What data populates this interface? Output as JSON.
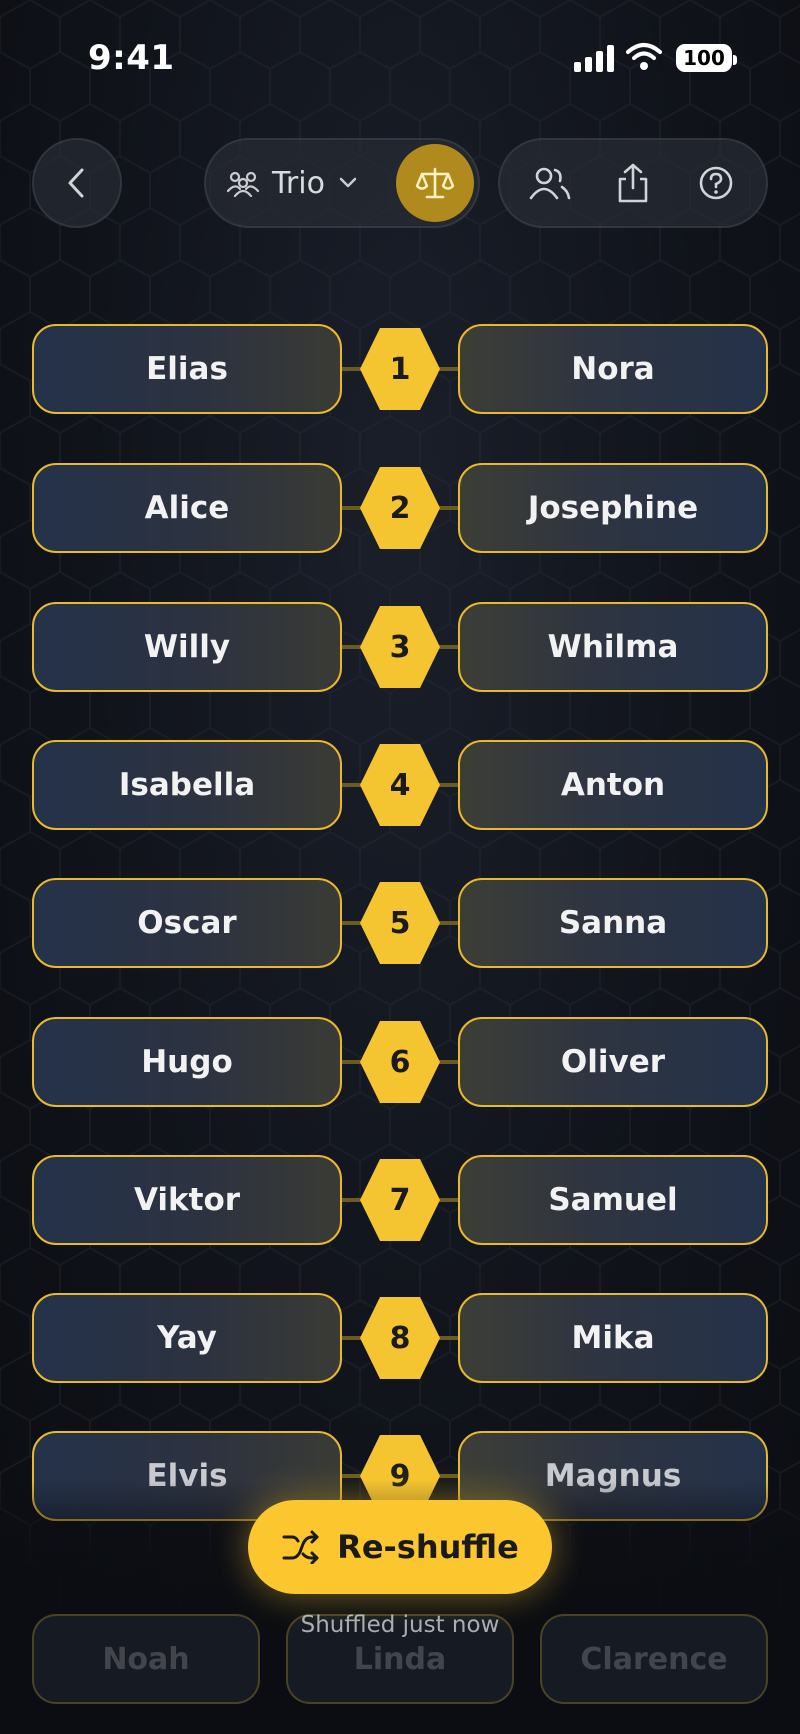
{
  "status_bar": {
    "time": "9:41",
    "battery": "100"
  },
  "toolbar": {
    "mode_label": "Trio",
    "icons": [
      "chevron-left-icon",
      "group-icon",
      "chevron-down-icon",
      "scale-icon",
      "people-icon",
      "share-icon",
      "help-icon"
    ]
  },
  "pairs": [
    {
      "number": "1",
      "left": "Elias",
      "right": "Nora"
    },
    {
      "number": "2",
      "left": "Alice",
      "right": "Josephine"
    },
    {
      "number": "3",
      "left": "Willy",
      "right": "Whilma"
    },
    {
      "number": "4",
      "left": "Isabella",
      "right": "Anton"
    },
    {
      "number": "5",
      "left": "Oscar",
      "right": "Sanna"
    },
    {
      "number": "6",
      "left": "Hugo",
      "right": "Oliver"
    },
    {
      "number": "7",
      "left": "Viktor",
      "right": "Samuel"
    },
    {
      "number": "8",
      "left": "Yay",
      "right": "Mika"
    },
    {
      "number": "9",
      "left": "Elvis",
      "right": "Magnus"
    }
  ],
  "leftover": [
    "Noah",
    "Linda",
    "Clarence"
  ],
  "reshuffle": {
    "label": "Re-shuffle",
    "status": "Shuffled just now"
  },
  "colors": {
    "accent": "#f5c531",
    "background": "#10131a",
    "balance_button": "#b08a1c"
  }
}
